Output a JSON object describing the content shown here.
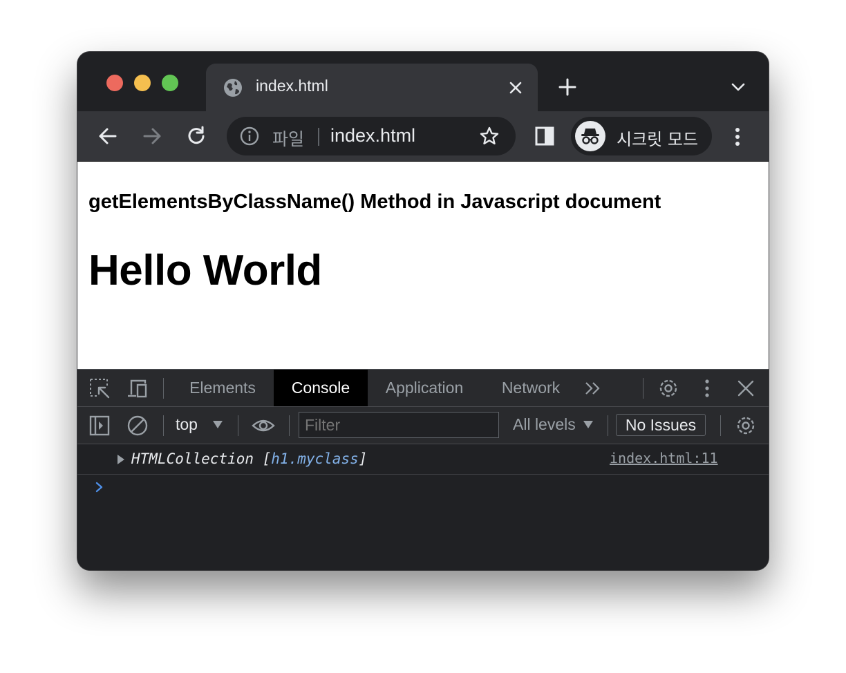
{
  "browser": {
    "tab": {
      "title": "index.html"
    },
    "address_bar": {
      "scheme_label": "파일",
      "url": "index.html"
    },
    "profile": {
      "label": "시크릿 모드"
    }
  },
  "page": {
    "heading3": "getElementsByClassName() Method in Javascript document",
    "heading1": "Hello World"
  },
  "devtools": {
    "tabs": [
      {
        "label": "Elements"
      },
      {
        "label": "Console",
        "active": true
      },
      {
        "label": "Application"
      },
      {
        "label": "Network"
      }
    ],
    "console": {
      "context": "top",
      "filter_placeholder": "Filter",
      "levels": "All levels",
      "issues": "No Issues",
      "log": {
        "prefix": "HTMLCollection [",
        "link": "h1.myclass",
        "suffix": "]",
        "source": "index.html:11"
      }
    }
  },
  "colors": {
    "frame": "#202124",
    "tab_active": "#35363a",
    "devtools_active_tab": "#000000",
    "log_link": "#82b1e8"
  },
  "icons": [
    "globe-icon",
    "close-icon",
    "plus-icon",
    "chevron-down-icon",
    "back-icon",
    "forward-icon",
    "reload-icon",
    "info-icon",
    "star-icon",
    "side-panel-icon",
    "incognito-icon",
    "kebab-icon",
    "inspect-icon",
    "device-icon",
    "more-tabs-icon",
    "gear-icon",
    "sidebar-toggle-icon",
    "clear-icon",
    "eye-icon",
    "prompt-icon"
  ]
}
